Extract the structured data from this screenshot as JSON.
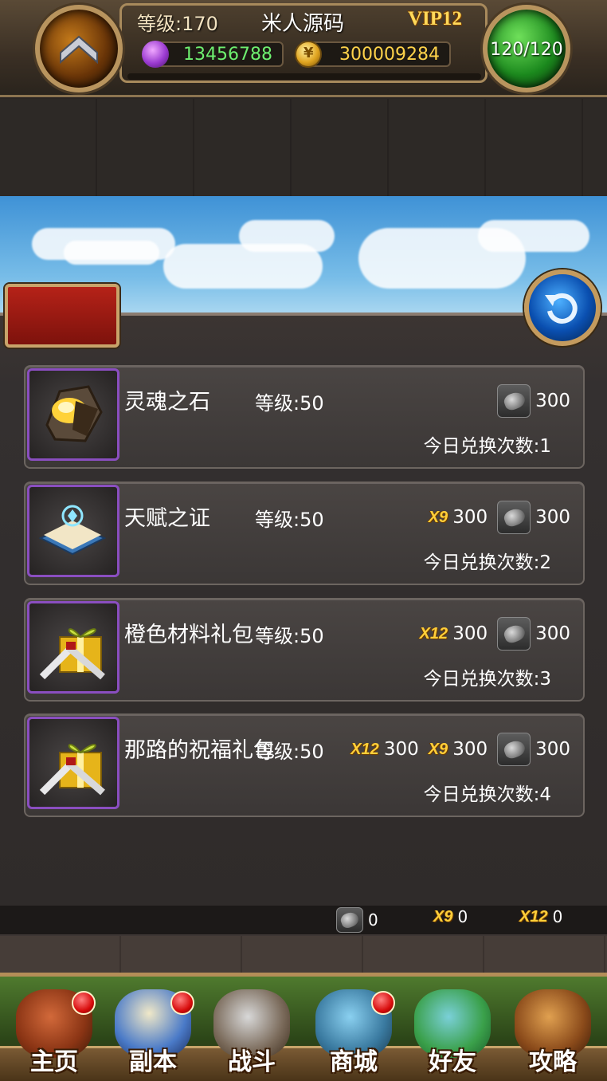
{
  "hud": {
    "level_text": "等级:170",
    "player_name": "米人源码",
    "vip": "VIP12",
    "gems": "13456788",
    "gold": "300009284",
    "energy": "120/120",
    "icons": [
      "rank-chevron-icon",
      "gem-icon",
      "gold-coin-icon"
    ]
  },
  "items": [
    {
      "name": "灵魂之石",
      "level": "等级:50",
      "icon": "soul-stone-icon",
      "costs": [
        {
          "currency": "stone",
          "amount": "300"
        }
      ],
      "count": "今日兑换次数:1"
    },
    {
      "name": "天赋之证",
      "level": "等级:50",
      "icon": "talent-book-icon",
      "costs": [
        {
          "currency": "x9",
          "amount": "300"
        },
        {
          "currency": "stone",
          "amount": "300"
        }
      ],
      "count": "今日兑换次数:2"
    },
    {
      "name": "橙色材料礼包",
      "level": "等级:50",
      "icon": "gift-box-icon",
      "costs": [
        {
          "currency": "x12",
          "amount": "300"
        },
        {
          "currency": "stone",
          "amount": "300"
        }
      ],
      "count": "今日兑换次数:3"
    },
    {
      "name": "那路的祝福礼包",
      "level": "等级:50",
      "icon": "gift-box-icon",
      "costs": [
        {
          "currency": "x12",
          "amount": "300"
        },
        {
          "currency": "x9",
          "amount": "300"
        },
        {
          "currency": "stone",
          "amount": "300"
        }
      ],
      "count": "今日兑换次数:4"
    }
  ],
  "currency_labels": {
    "x9": "X9",
    "x12": "X12"
  },
  "footer": {
    "stone": "0",
    "x9": "0",
    "x12": "0"
  },
  "nav": [
    {
      "label": "主页",
      "icon": "house-icon",
      "badge": true
    },
    {
      "label": "副本",
      "icon": "skull-icon",
      "badge": true
    },
    {
      "label": "战斗",
      "icon": "swords-icon",
      "badge": false
    },
    {
      "label": "商城",
      "icon": "shop-monster-icon",
      "badge": true
    },
    {
      "label": "好友",
      "icon": "friends-icon",
      "badge": false
    },
    {
      "label": "攻略",
      "icon": "guide-book-icon",
      "badge": false
    }
  ]
}
